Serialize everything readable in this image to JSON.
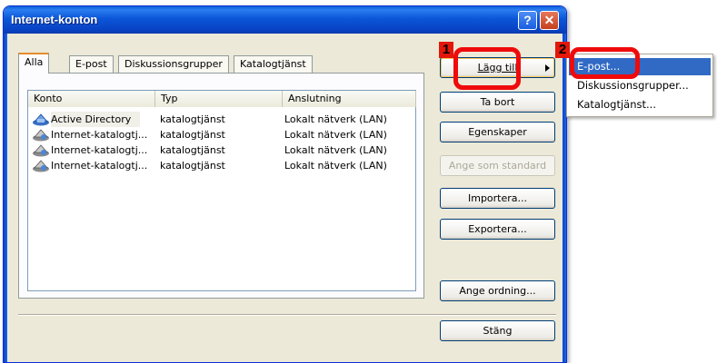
{
  "window": {
    "title": "Internet-konton",
    "help_glyph": "?",
    "close_glyph": "✕"
  },
  "tabs": [
    {
      "label": "Alla",
      "active": true
    },
    {
      "label": "E-post",
      "active": false
    },
    {
      "label": "Diskussionsgrupper",
      "active": false
    },
    {
      "label": "Katalogtjänst",
      "active": false
    }
  ],
  "list": {
    "columns": [
      "Konto",
      "Typ",
      "Anslutning"
    ],
    "rows": [
      {
        "icon": "directory-icon",
        "konto": "Active Directory",
        "typ": "katalogtjänst",
        "anslutning": "Lokalt nätverk (LAN)"
      },
      {
        "icon": "internet-directory-icon",
        "konto": "Internet-katalogtj...",
        "typ": "katalogtjänst",
        "anslutning": "Lokalt nätverk (LAN)"
      },
      {
        "icon": "internet-directory-icon",
        "konto": "Internet-katalogtj...",
        "typ": "katalogtjänst",
        "anslutning": "Lokalt nätverk (LAN)"
      },
      {
        "icon": "internet-directory-icon",
        "konto": "Internet-katalogtj...",
        "typ": "katalogtjänst",
        "anslutning": "Lokalt nätverk (LAN)"
      }
    ]
  },
  "buttons": {
    "add": "Lägg till",
    "remove": "Ta bort",
    "properties": "Egenskaper",
    "set_default": "Ange som standard",
    "import": "Importera...",
    "export": "Exportera...",
    "order": "Ange ordning...",
    "close": "Stäng"
  },
  "context_menu": {
    "items": [
      "E-post...",
      "Diskussionsgrupper...",
      "Katalogtjänst..."
    ],
    "selected_index": 0
  },
  "annotations": {
    "step1": "1",
    "step2": "2",
    "color": "#ef0b0b"
  },
  "colors": {
    "titlebar": "#0b56d8",
    "dialog_bg": "#ece9d8",
    "menu_highlight": "#316ac5"
  }
}
